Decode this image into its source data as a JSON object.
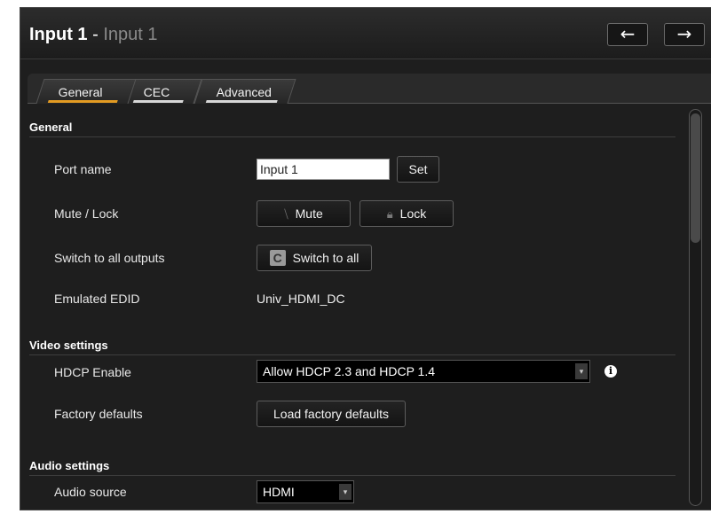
{
  "header": {
    "title_main": "Input 1",
    "title_sep": " - ",
    "title_sub": "Input 1",
    "prev_label": "←",
    "next_label": "→"
  },
  "tabs": [
    {
      "label": "General",
      "active": true
    },
    {
      "label": "CEC",
      "active": false
    },
    {
      "label": "Advanced",
      "active": false
    }
  ],
  "sections": {
    "general": {
      "title": "General",
      "port_name_label": "Port name",
      "port_name_value": "Input 1",
      "set_label": "Set",
      "mute_lock_label": "Mute / Lock",
      "mute_label": "Mute",
      "lock_label": "Lock",
      "switch_label": "Switch to all outputs",
      "switch_button_label": "Switch to all",
      "switch_icon_glyph": "C",
      "edid_label": "Emulated EDID",
      "edid_value": "Univ_HDMI_DC"
    },
    "video": {
      "title": "Video settings",
      "hdcp_label": "HDCP Enable",
      "hdcp_value": "Allow HDCP 2.3 and HDCP 1.4",
      "factory_label": "Factory defaults",
      "factory_button_label": "Load factory defaults"
    },
    "audio": {
      "title": "Audio settings",
      "source_label": "Audio source",
      "source_value": "HDMI"
    }
  },
  "icons": {
    "mute": "speaker-muted-icon",
    "lock": "lock-icon",
    "info": "info-icon",
    "caret": "chevron-down-icon"
  },
  "colors": {
    "accent": "#e39b22",
    "background": "#1e1e1e"
  }
}
